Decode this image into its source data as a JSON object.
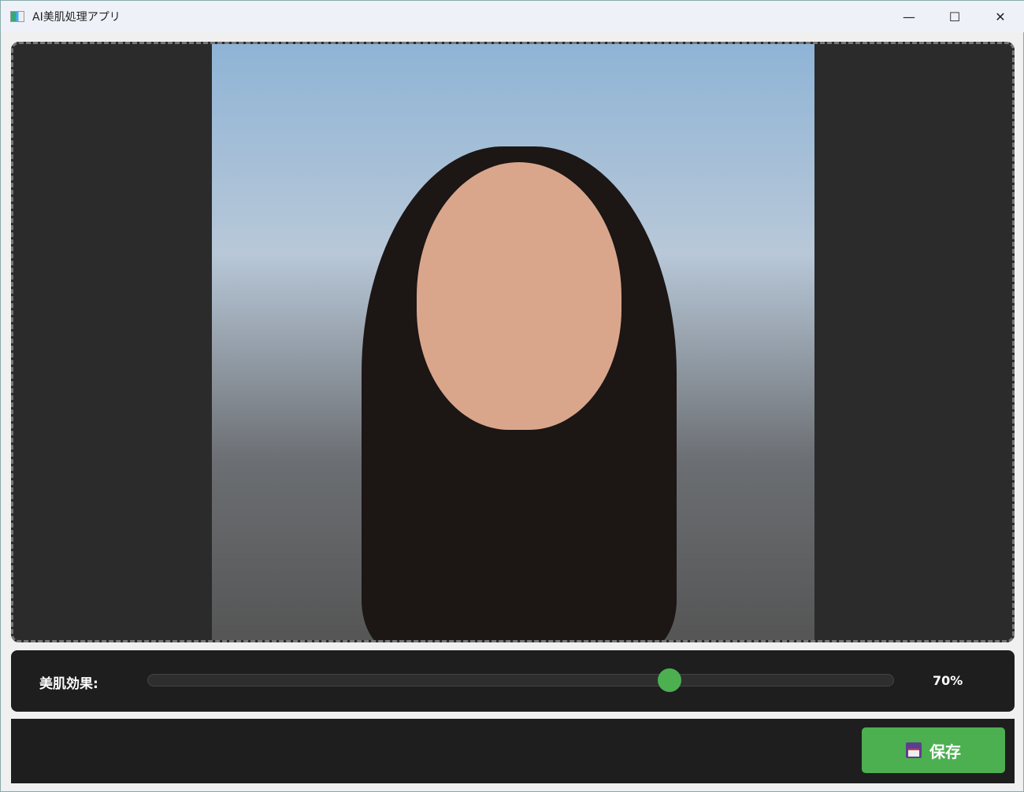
{
  "window": {
    "title": "AI美肌処理アプリ",
    "minimize": "—",
    "maximize": "☐",
    "close": "✕"
  },
  "controls": {
    "label": "美肌効果:",
    "value_text": "70%",
    "value": 70,
    "min": 0,
    "max": 100
  },
  "footer": {
    "save_label": "保存",
    "save_icon": "floppy-disk-icon"
  },
  "colors": {
    "accent": "#4caf50",
    "panel": "#1e1e1e"
  }
}
